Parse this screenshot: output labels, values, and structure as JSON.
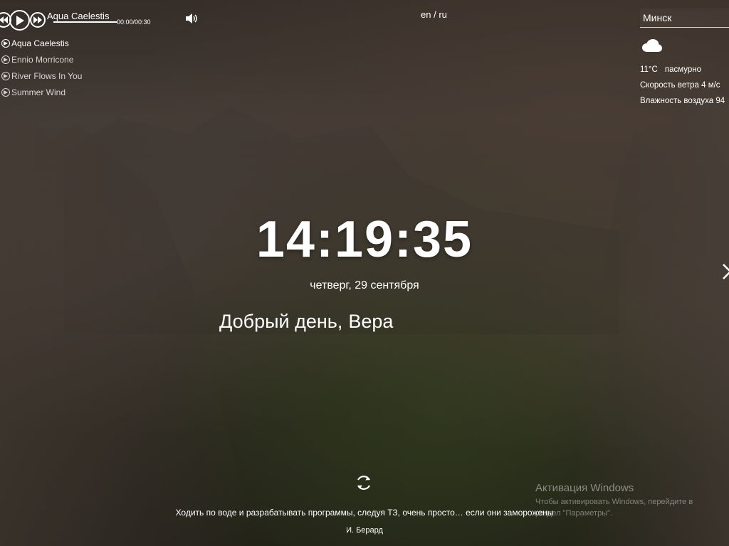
{
  "player": {
    "current_track": "Aqua Caelestis",
    "time": "00:00/00:30",
    "progress": 0,
    "playlist": [
      {
        "title": "Aqua Caelestis",
        "active": true
      },
      {
        "title": "Ennio Morricone",
        "active": false
      },
      {
        "title": "River Flows In You",
        "active": false
      },
      {
        "title": "Summer Wind",
        "active": false
      }
    ]
  },
  "language": {
    "en": "en",
    "separator": "/",
    "ru": "ru"
  },
  "weather": {
    "city": "Минск",
    "icon": "cloud-icon",
    "temperature": "11°C",
    "description": "пасмурно",
    "wind": "Скорость ветра 4 м/с",
    "humidity": "Влажность воздуха 94"
  },
  "clock": {
    "time": "14:19:35",
    "date": "четверг, 29 сентября"
  },
  "greeting": {
    "text": "Добрый день,",
    "name": "Вера"
  },
  "quote": {
    "text": "Ходить по воде и разрабатывать программы, следуя ТЗ, очень просто… если они заморожены",
    "author": "И. Берард"
  },
  "watermark": {
    "title": "Активация Windows",
    "line1": "Чтобы активировать Windows, перейдите в",
    "line2": "раздел \"Параметры\"."
  }
}
